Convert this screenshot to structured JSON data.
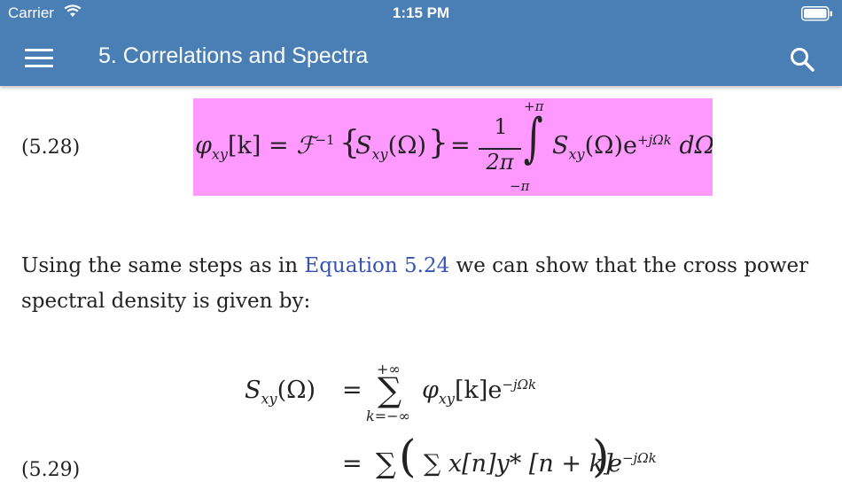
{
  "status": {
    "carrier": "Carrier",
    "time": "1:15 PM"
  },
  "nav": {
    "title": "5. Correlations and Spectra",
    "menu_icon": "hamburger-menu-icon",
    "search_icon": "search-icon"
  },
  "colors": {
    "header": "#4a7fb6",
    "highlight": "#ff99ff",
    "link": "#3454b4"
  },
  "eq1": {
    "label": "(5.28)",
    "phi": "φ",
    "sub_xy": "xy",
    "k_bracket": "[k] = ",
    "F": "ℱ",
    "inv": "−1",
    "lbrace": "{",
    "S": "S",
    "omega": "(Ω)",
    "rbrace": "}",
    "eq": "=",
    "num": "1",
    "den": "2π",
    "upper": "+π",
    "lower": "−π",
    "integral": "∫",
    "integrand_S": "S",
    "integrand_omega": "(Ω)e",
    "exp": "+jΩk",
    "dOmega": "dΩ"
  },
  "paragraph": {
    "before": "Using the same steps as in ",
    "link": "Equation 5.24",
    "after": " we can show that the cross power spectral density is given by:"
  },
  "eq2": {
    "lhs_S": "S",
    "sub_xy": "xy",
    "lhs_omega": "(Ω)",
    "eq": "=",
    "sum_upper": "+∞",
    "sum": "∑",
    "sum_lower": "k=−∞",
    "rhs": "φ",
    "rhs_sub": "xy",
    "rhs_k": "[k]e",
    "rhs_exp": "−jΩk",
    "line2_eq": "=",
    "line2_sum": "∑",
    "lparen": "(",
    "line2_body": "∑ x[n]y* [n + k]",
    "rparen": ")",
    "line2_e": "e",
    "line2_exp": "−jΩk",
    "label_partial": "(5.29)"
  }
}
